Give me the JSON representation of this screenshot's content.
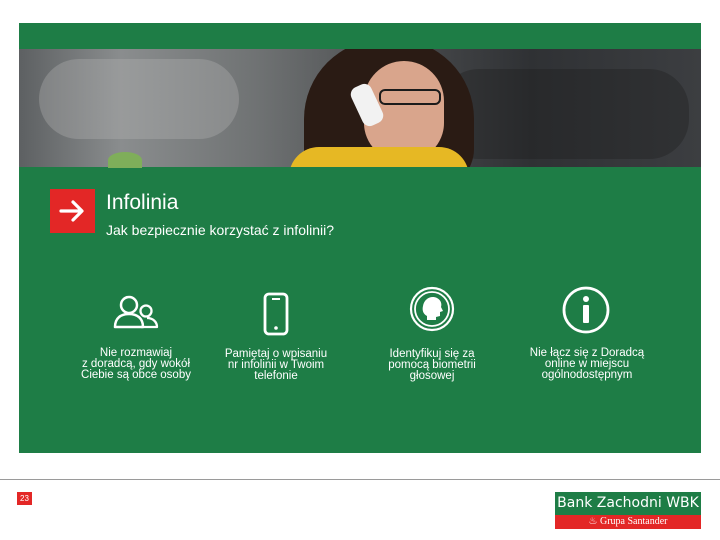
{
  "header": {
    "title": "Infolinia",
    "subtitle": "Jak bezpiecznie korzystać z infolinii?"
  },
  "tips": [
    {
      "icon": "people-icon",
      "lines": [
        "Nie rozmawiaj",
        "z doradcą, gdy wokół",
        "Ciebie są obce osoby"
      ]
    },
    {
      "icon": "smartphone-icon",
      "lines": [
        "Pamiętaj o wpisaniu",
        "nr infolinii w Twoim",
        "telefonie"
      ]
    },
    {
      "icon": "voice-biometric-icon",
      "lines": [
        "Identyfikuj się za",
        "pomocą biometrii",
        "głosowej"
      ]
    },
    {
      "icon": "info-icon",
      "lines": [
        "Nie łącz się z Doradcą",
        "online w miejscu",
        "ogólnodostępnym"
      ]
    }
  ],
  "footer": {
    "page_number": "23",
    "logo_name": "Bank Zachodni WBK",
    "logo_group": "Grupa Santander"
  },
  "colors": {
    "panel_green": "#1e7d46",
    "accent_red": "#e32726"
  }
}
